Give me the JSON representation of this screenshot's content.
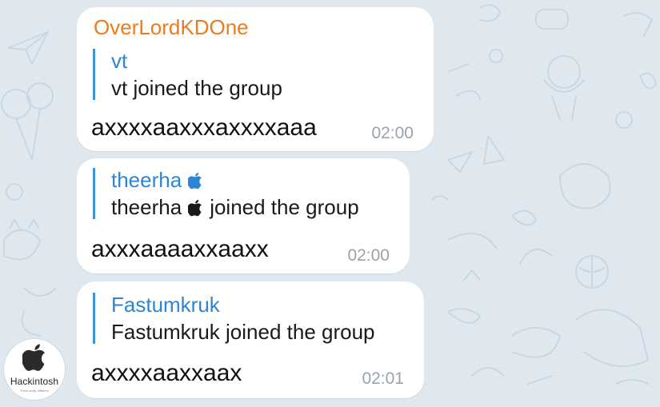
{
  "messages": [
    {
      "sender": "OverLordKDOne",
      "reply_name": "vt",
      "reply_text": "vt joined the group",
      "text": "axxxxaaxxxaxxxxaaa",
      "time": "02:00"
    },
    {
      "sender": "",
      "reply_name": "theerha",
      "reply_text_before": "theerha",
      "reply_text_after": "joined the group",
      "text": "axxxaaaaxxaaxx",
      "time": "02:00"
    },
    {
      "sender": "",
      "reply_name": "Fastumkruk",
      "reply_text": "Fastumkruk joined the group",
      "text": "axxxxaaxxaax",
      "time": "02:01"
    }
  ],
  "avatar": {
    "title": "Hackintosh",
    "subtitle": "Think really different",
    "icon": "apple-logo-icon"
  },
  "colors": {
    "background": "#dfe8ef",
    "sender": "#ec7c1c",
    "reply_accent": "#3a93db",
    "reply_name": "#2d86d4",
    "time": "#9aa3ab"
  }
}
